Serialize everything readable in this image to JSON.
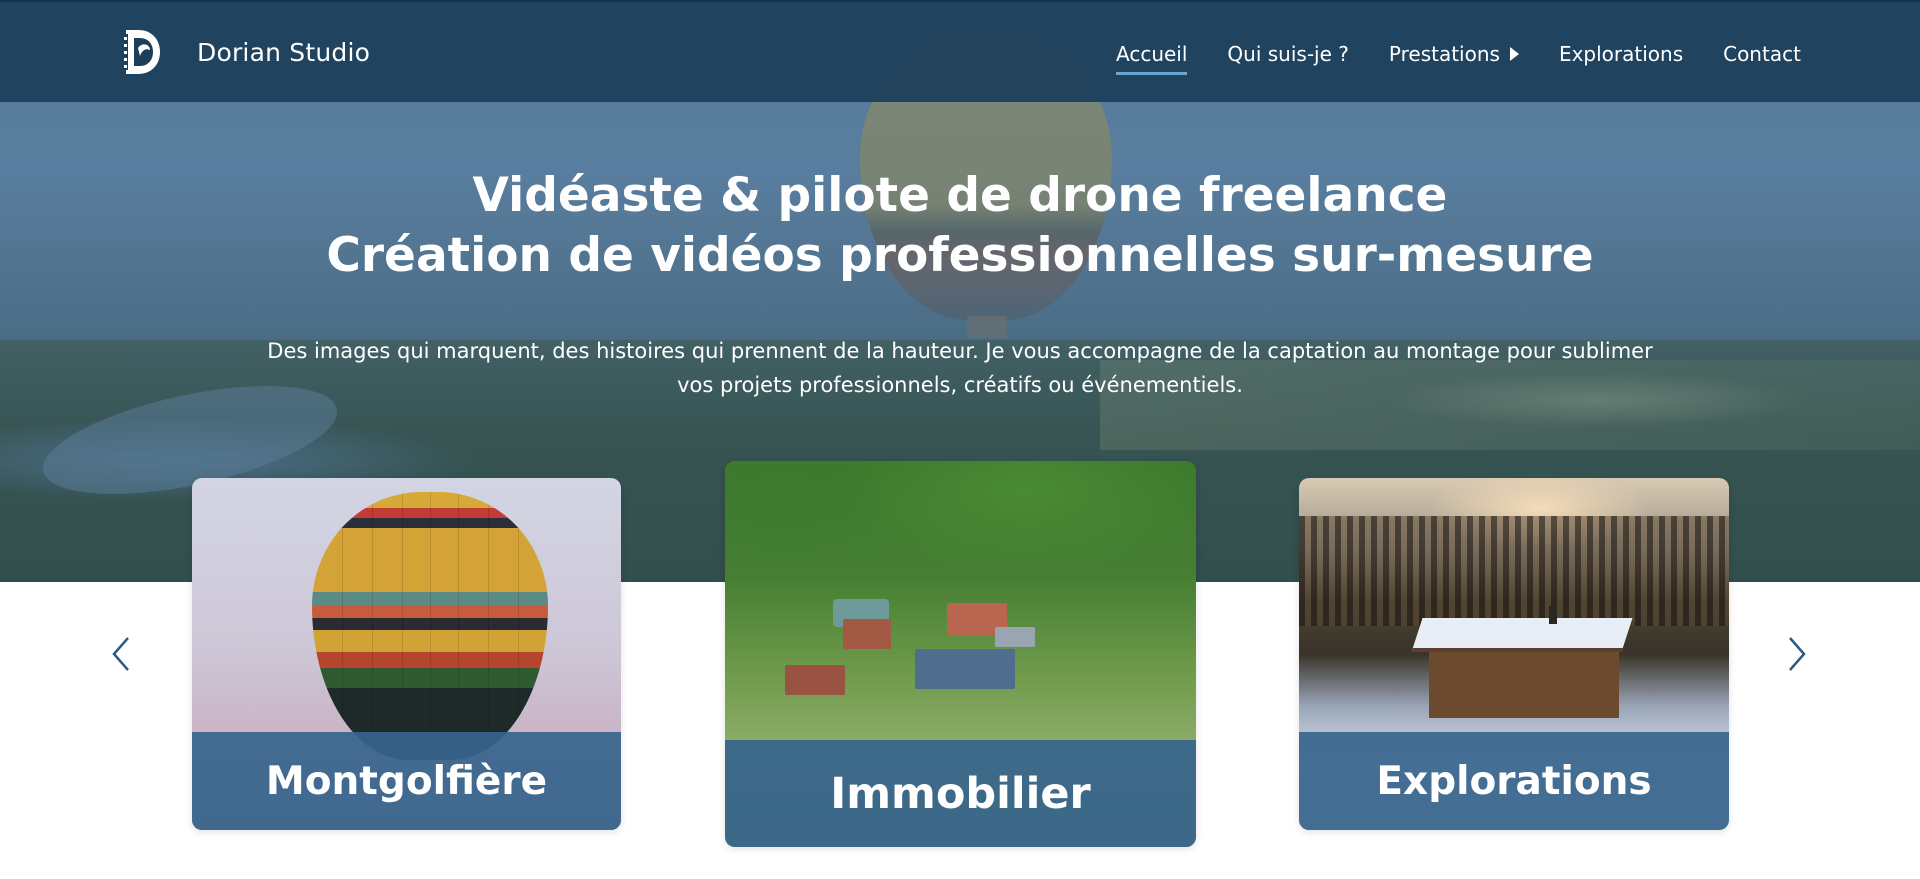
{
  "header": {
    "brand": "Dorian Studio",
    "logo_icon": "film-d-logo-icon",
    "nav": [
      {
        "label": "Accueil",
        "active": true
      },
      {
        "label": "Qui suis-je ?"
      },
      {
        "label": "Prestations",
        "has_submenu": true
      },
      {
        "label": "Explorations"
      },
      {
        "label": "Contact"
      }
    ]
  },
  "hero": {
    "title_line1": "Vidéaste & pilote de drone freelance",
    "title_line2": "Création de vidéos professionnelles sur-mesure",
    "subtitle_line1": "Des images qui marquent, des histoires qui prennent de la hauteur. Je vous accompagne de la captation au montage pour sublimer",
    "subtitle_line2": "vos projets professionnels, créatifs ou événementiels."
  },
  "carousel": {
    "prev_icon": "chevron-left-icon",
    "next_icon": "chevron-right-icon",
    "cards": [
      {
        "label": "Montgolfière",
        "image": "hot-air-balloon-photo"
      },
      {
        "label": "Immobilier",
        "image": "aerial-farm-photo"
      },
      {
        "label": "Explorations",
        "image": "snowy-cabin-photo"
      }
    ]
  },
  "colors": {
    "header_bg": "#1b3e5a",
    "card_band": "#37648c",
    "accent_underline": "#6aa6cf",
    "arrow": "#2c5a80"
  }
}
